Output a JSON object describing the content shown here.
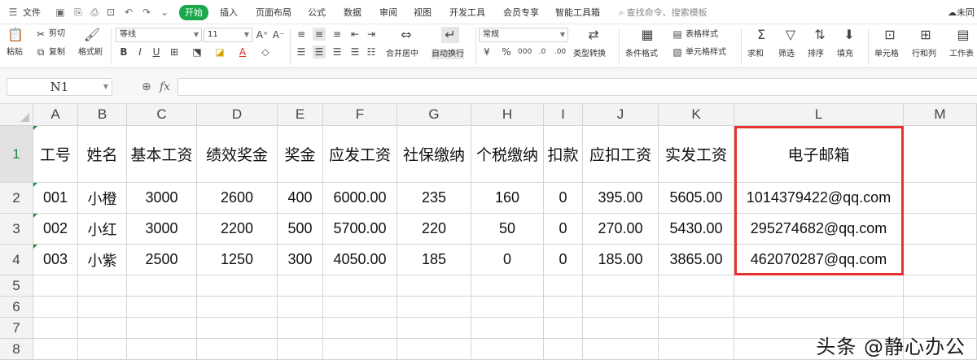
{
  "menubar": {
    "file": "文件",
    "tabs": [
      "开始",
      "插入",
      "页面布局",
      "公式",
      "数据",
      "审阅",
      "视图",
      "开发工具",
      "会员专享",
      "智能工具箱"
    ],
    "search": "查找命令、搜索模板",
    "account": "未同"
  },
  "ribbon": {
    "paste": "粘贴",
    "cut": "剪切",
    "copy": "复制",
    "format_painter": "格式刷",
    "font_name": "等线",
    "font_size": "11",
    "merge_center": "合并居中",
    "wrap_text": "自动换行",
    "number_format": "常规",
    "type_convert": "类型转换",
    "conditional_format": "条件格式",
    "table_style": "表格样式",
    "cell_style": "单元格样式",
    "sum": "求和",
    "filter": "筛选",
    "sort": "排序",
    "fill": "填充",
    "cell": "单元格",
    "rows_cols": "行和列",
    "worksheet": "工作表"
  },
  "formula_bar": {
    "name_box": "N1",
    "fx": "fx",
    "value": ""
  },
  "sheet": {
    "columns": [
      "A",
      "B",
      "C",
      "D",
      "E",
      "F",
      "G",
      "H",
      "I",
      "J",
      "K",
      "L",
      "M"
    ],
    "rows": [
      "1",
      "2",
      "3",
      "4",
      "5",
      "6",
      "7",
      "8"
    ],
    "header": [
      "工号",
      "姓名",
      "基本工资",
      "绩效奖金",
      "奖金",
      "应发工资",
      "社保缴纳",
      "个税缴纳",
      "扣款",
      "应扣工资",
      "实发工资",
      "电子邮箱"
    ],
    "data": [
      [
        "001",
        "小橙",
        "3000",
        "2600",
        "400",
        "6000.00",
        "235",
        "160",
        "0",
        "395.00",
        "5605.00",
        "1014379422@qq.com"
      ],
      [
        "002",
        "小红",
        "3000",
        "2200",
        "500",
        "5700.00",
        "220",
        "50",
        "0",
        "270.00",
        "5430.00",
        "295274682@qq.com"
      ],
      [
        "003",
        "小紫",
        "2500",
        "1250",
        "300",
        "4050.00",
        "185",
        "0",
        "0",
        "185.00",
        "3865.00",
        "462070287@qq.com"
      ]
    ]
  },
  "highlight_color": "#e8322f",
  "accent_color": "#1aa84a",
  "watermark": "头条 @静心办公"
}
